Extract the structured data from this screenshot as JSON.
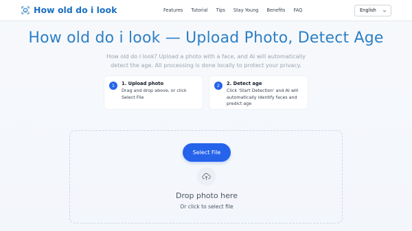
{
  "brand": {
    "name": "How old do i look",
    "logo_icon": "face-scan-icon",
    "color": "#1a6fc0"
  },
  "nav": {
    "links": [
      "Features",
      "Tutorial",
      "Tips",
      "Stay Young",
      "Benefits",
      "FAQ"
    ],
    "language": {
      "selected": "English",
      "icon": "chevron-down-icon"
    }
  },
  "hero": {
    "title": "How old do i look — Upload Photo, Detect Age",
    "subtitle": "How old do I look? Upload a photo with a face, and AI will automatically detect the age. All processing is done locally to protect your privacy."
  },
  "steps": [
    {
      "number": "1",
      "title": "1. Upload photo",
      "description": "Drag and drop above, or click Select File"
    },
    {
      "number": "2",
      "title": "2. Detect age",
      "description": "Click 'Start Detection' and AI will automatically identify faces and predict age"
    }
  ],
  "dropzone": {
    "button_label": "Select File",
    "icon": "cloud-upload-icon",
    "title": "Drop photo here",
    "subtitle": "Or click to select file"
  },
  "colors": {
    "accent": "#2563eb",
    "title": "#2b7fc6",
    "muted": "#9ca3af"
  }
}
